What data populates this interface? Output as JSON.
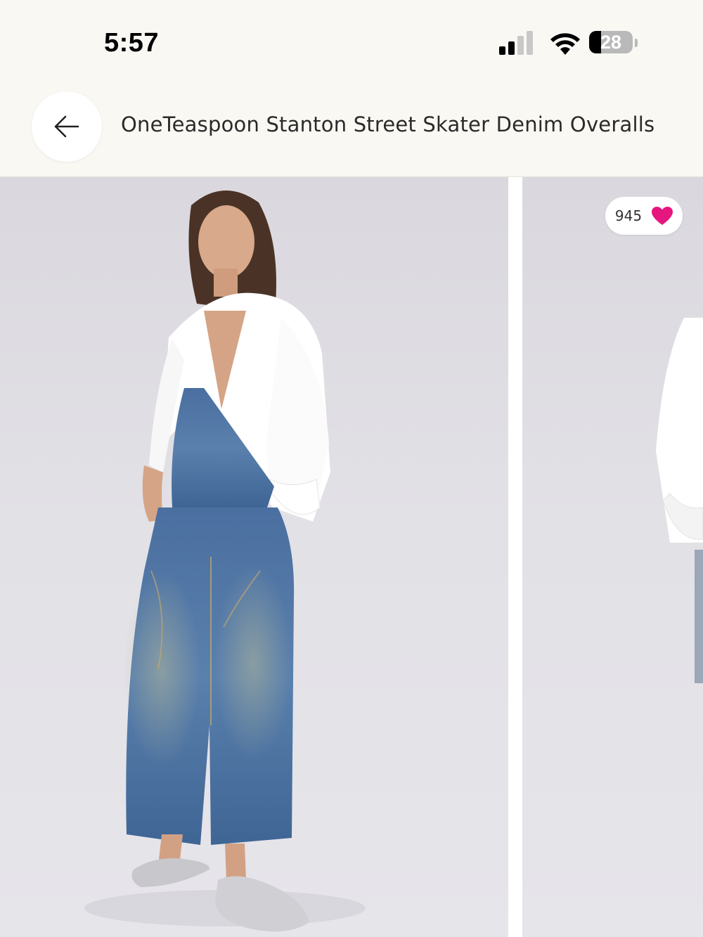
{
  "status_bar": {
    "time": "5:57",
    "battery_level": "28",
    "battery_fraction": 0.28,
    "icons": [
      "cellular-signal-icon",
      "wifi-icon",
      "battery-icon"
    ]
  },
  "header": {
    "back_icon": "arrow-left-icon",
    "title": "OneTeaspoon Stanton Street Skater Denim Overalls"
  },
  "gallery": {
    "images": [
      {
        "name": "product-photo-1",
        "description_icon": "model-front-view"
      },
      {
        "name": "product-photo-2",
        "description_icon": "model-side-view-partial"
      }
    ],
    "likes": {
      "count": "945",
      "icon": "heart-icon",
      "icon_color": "#e5177e"
    }
  },
  "colors": {
    "background": "#faf8f3",
    "text": "#2a2a2a",
    "heart": "#e5177e"
  }
}
